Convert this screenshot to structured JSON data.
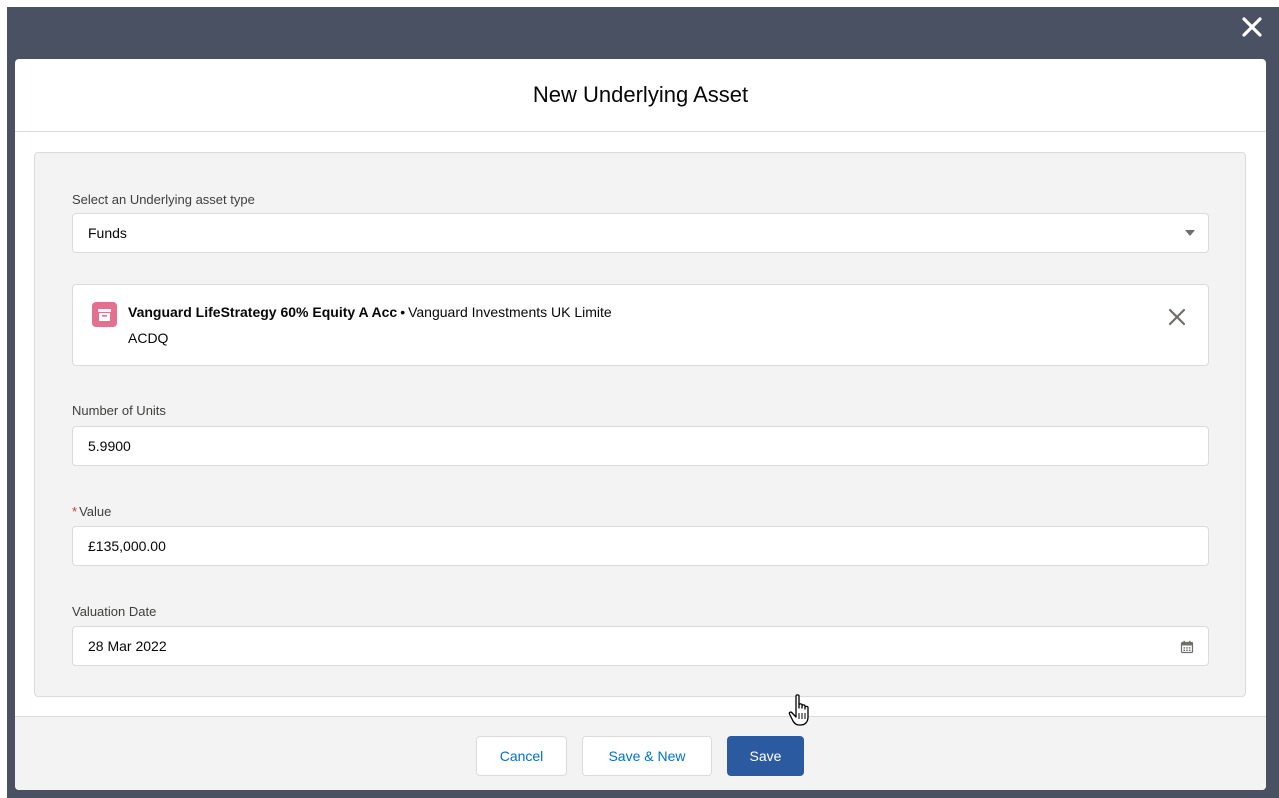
{
  "modal": {
    "title": "New Underlying Asset",
    "close_icon": "close-icon"
  },
  "form": {
    "asset_type": {
      "label": "Select an Underlying asset type",
      "value": "Funds",
      "icon": "chevron-down-icon"
    },
    "lookup": {
      "icon": "fund-icon",
      "name": "Vanguard LifeStrategy 60% Equity A Acc",
      "separator": "•",
      "provider": "Vanguard Investments UK Limite",
      "code": "ACDQ",
      "remove_icon": "close-icon"
    },
    "units": {
      "label": "Number of Units",
      "value": "5.9900"
    },
    "value": {
      "required_marker": "*",
      "label": "Value",
      "value": "£135,000.00"
    },
    "valuation_date": {
      "label": "Valuation Date",
      "value": "28 Mar 2022",
      "icon": "calendar-icon"
    }
  },
  "footer": {
    "cancel_label": "Cancel",
    "save_new_label": "Save & New",
    "save_label": "Save"
  },
  "colors": {
    "backdrop": "#4a5163",
    "brand": "#2c5aa0",
    "link": "#0070d2",
    "fund_icon": "#e3708f",
    "required": "#c23934"
  }
}
